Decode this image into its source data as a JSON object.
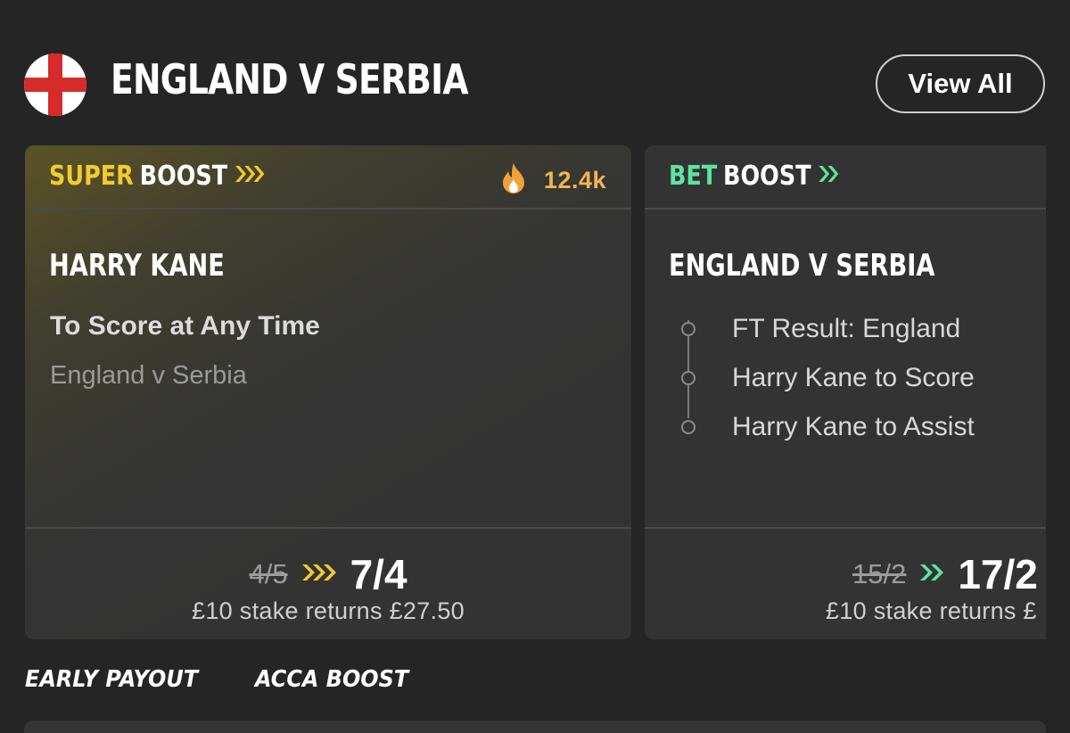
{
  "header": {
    "flag_icon": "england-flag-icon",
    "title": "ENGLAND V SERBIA",
    "view_all_label": "View All"
  },
  "cards": {
    "super_boost": {
      "label_accent": "SUPER",
      "label_rest": "BOOST",
      "accent_color": "#f2cb2c",
      "chevron_icon": "triple-chevron-right-icon",
      "popularity_icon": "flame-icon",
      "popularity_count": "12.4k",
      "selection": "HARRY KANE",
      "market": "To Score at Any Time",
      "event": "England v Serbia",
      "old_odds": "4/5",
      "new_odds": "7/4",
      "returns": "£10 stake returns £27.50"
    },
    "bet_boost": {
      "label_accent": "BET",
      "label_rest": "BOOST",
      "accent_color": "#5ee3a1",
      "chevron_icon": "double-chevron-right-icon",
      "selection": "ENGLAND V SERBIA",
      "legs": [
        "FT Result: England",
        "Harry Kane to Score",
        "Harry Kane to Assist"
      ],
      "old_odds": "15/2",
      "new_odds": "17/2",
      "returns": "£10 stake returns £"
    }
  },
  "tabs": [
    "EARLY PAYOUT",
    "ACCA BOOST"
  ]
}
